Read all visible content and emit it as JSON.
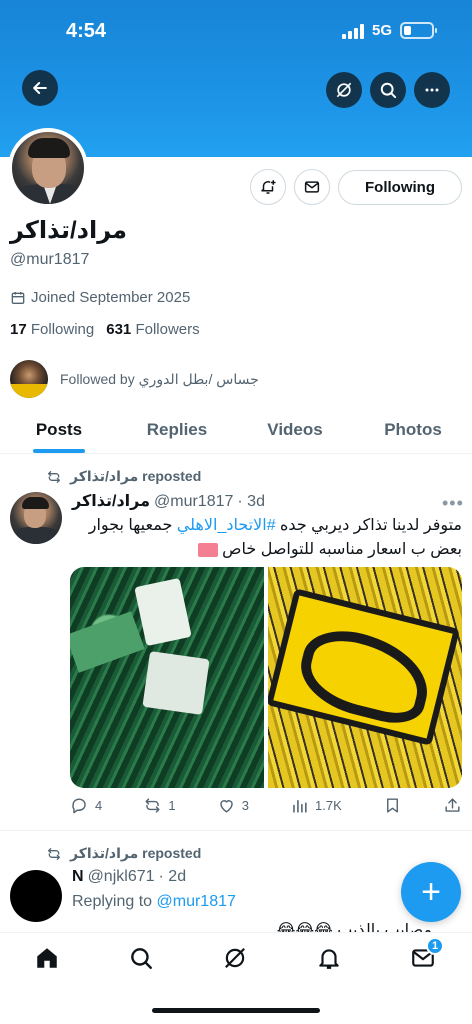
{
  "status_bar": {
    "time": "4:54",
    "network": "5G"
  },
  "profile": {
    "display_name": "مراد/تذاكر",
    "handle": "@mur1817",
    "joined": "Joined September 2025",
    "following_count": "17",
    "following_label": "Following",
    "followers_count": "631",
    "followers_label": "Followers",
    "followed_by": "Followed by جساس /بطل الدوري",
    "follow_button": "Following"
  },
  "tabs": [
    {
      "label": "Posts",
      "active": true
    },
    {
      "label": "Replies",
      "active": false
    },
    {
      "label": "Videos",
      "active": false
    },
    {
      "label": "Photos",
      "active": false
    }
  ],
  "posts": [
    {
      "repost_label": "مراد/تذاكر reposted",
      "author": "مراد/تذاكر",
      "handle": "@mur1817",
      "time": "· 3d",
      "text_before": "متوفر لدينا تذاكر ديربي جده ",
      "hashtag": "#الاتحاد_الاهلي",
      "text_after": " جمعيها بجوار بعض ب اسعار مناسبه للتواصل خاص",
      "replies": "4",
      "reposts": "1",
      "likes": "3",
      "views": "1.7K"
    },
    {
      "repost_label": "مراد/تذاكر reposted",
      "author": "N",
      "handle": "@njkl671",
      "time": "· 2d",
      "replying_prefix": "Replying to",
      "replying_to": "@mur1817",
      "text": "مصايب بالذيب 😂😂😂"
    }
  ],
  "nav": {
    "messages_badge": "1"
  },
  "colors": {
    "accent": "#1d9bf0",
    "banner": "#1d93e6",
    "text": "#0f1419",
    "muted": "#536471"
  }
}
